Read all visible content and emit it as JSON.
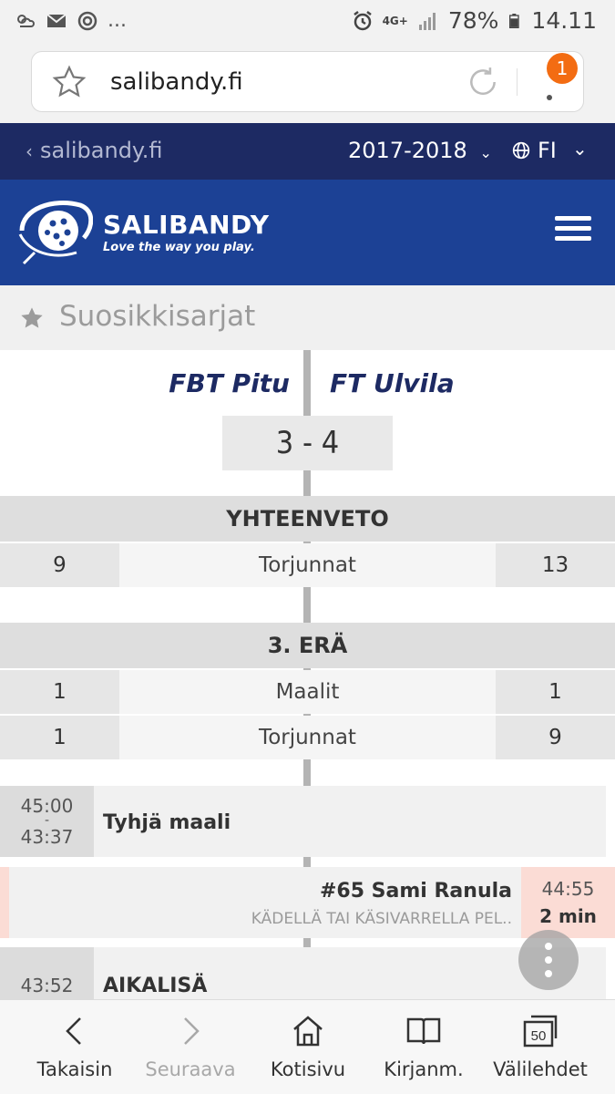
{
  "status_bar": {
    "left_icons": [
      "weather-icon",
      "mail-icon",
      "sync-icon"
    ],
    "more": "...",
    "network": "4G+",
    "battery": "78%",
    "time": "14.11"
  },
  "browser": {
    "url": "salibandy.fi",
    "notification_count": "1"
  },
  "site_nav": {
    "back_label": "salibandy.fi",
    "season": "2017-2018",
    "language": "FI"
  },
  "header": {
    "brand": "SALIBANDY",
    "tagline": "Love the way you play."
  },
  "favorites": {
    "label": "Suosikkisarjat"
  },
  "match": {
    "home_team": "FBT Pitu",
    "away_team": "FT Ulvila",
    "score": "3 - 4"
  },
  "summary": {
    "title": "YHTEENVETO",
    "rows": [
      {
        "home": "9",
        "label": "Torjunnat",
        "away": "13"
      }
    ]
  },
  "period": {
    "title": "3. ERÄ",
    "rows": [
      {
        "home": "1",
        "label": "Maalit",
        "away": "1"
      },
      {
        "home": "1",
        "label": "Torjunnat",
        "away": "9"
      }
    ]
  },
  "events": [
    {
      "time_start": "45:00",
      "separator": "-",
      "time_end": "43:37",
      "title": "Tyhjä maali"
    },
    {
      "player": "#65 Sami Ranula",
      "reason": "KÄDELLÄ TAI KÄSIVARRELLA PEL..",
      "time": "44:55",
      "penalty": "2 min"
    },
    {
      "time": "43:52",
      "title": "AIKALISÄ"
    }
  ],
  "bottom_bar": {
    "items": [
      {
        "label": "Takaisin",
        "icon": "back-icon"
      },
      {
        "label": "Seuraava",
        "icon": "forward-icon"
      },
      {
        "label": "Kotisivu",
        "icon": "home-icon"
      },
      {
        "label": "Kirjanm.",
        "icon": "bookmarks-icon"
      },
      {
        "label": "Välilehdet",
        "icon": "tabs-icon",
        "tab_count": "50"
      }
    ]
  },
  "colors": {
    "nav_dark": "#1d2a63",
    "header_blue": "#1c4195",
    "badge_orange": "#f36c12",
    "penalty_pink": "#fbdcd5"
  }
}
